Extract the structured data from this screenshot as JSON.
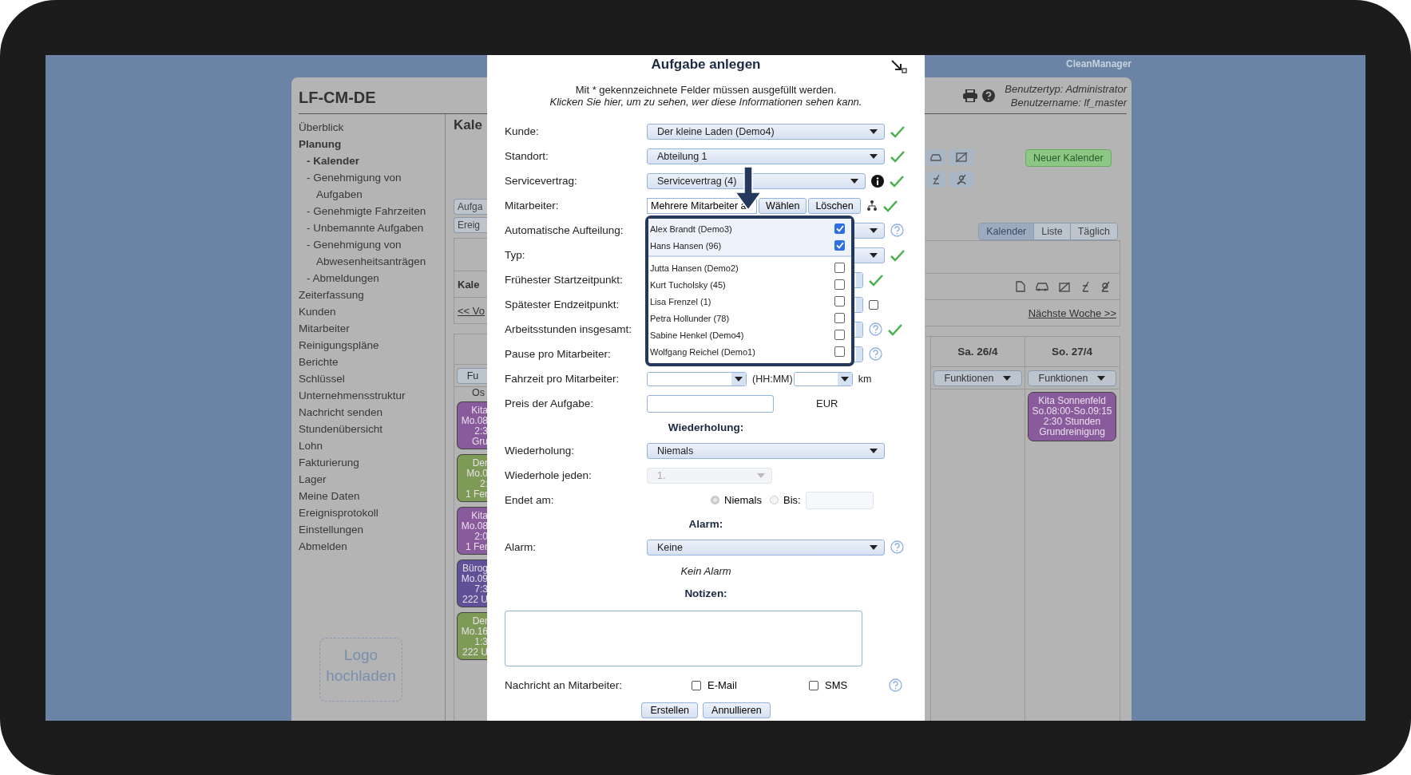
{
  "brand": "CleanManager",
  "app": {
    "title": "LF-CM-DE",
    "user_type": "Benutzertyp: Administrator",
    "user_name": "Benutzername: lf_master"
  },
  "sidebar": {
    "items": [
      {
        "label": "Überblick",
        "selected": false
      },
      {
        "label": "Planung",
        "expanded": true,
        "children": [
          {
            "label": "- Kalender",
            "selected": true
          },
          {
            "label": "- Genehmigung von Aufgaben",
            "selected": false
          },
          {
            "label": "- Genehmigte Fahrzeiten",
            "selected": false
          },
          {
            "label": "- Unbemannte Aufgaben",
            "selected": false
          },
          {
            "label": "- Genehmigung von Abwesenheitsanträgen",
            "selected": false
          },
          {
            "label": "- Abmeldungen",
            "selected": false
          }
        ]
      },
      {
        "label": "Zeiterfassung",
        "selected": false
      },
      {
        "label": "Kunden",
        "selected": false
      },
      {
        "label": "Mitarbeiter",
        "selected": false
      },
      {
        "label": "Reinigungspläne",
        "selected": false
      },
      {
        "label": "Berichte",
        "selected": false
      },
      {
        "label": "Schlüssel",
        "selected": false
      },
      {
        "label": "Unternehmensstruktur",
        "selected": false
      },
      {
        "label": "Nachricht senden",
        "selected": false
      },
      {
        "label": "Stundenübersicht",
        "selected": false
      },
      {
        "label": "Lohn",
        "selected": false
      },
      {
        "label": "Fakturierung",
        "selected": false
      },
      {
        "label": "Lager",
        "selected": false
      },
      {
        "label": "Meine Daten",
        "selected": false
      },
      {
        "label": "Ereignisprotokoll",
        "selected": false
      },
      {
        "label": "Einstellungen",
        "selected": false
      },
      {
        "label": "Abmelden",
        "selected": false
      }
    ],
    "logo_upload": "Logo hochladen"
  },
  "calendar_left": {
    "title": "Kale",
    "buttons": [
      "Aufga",
      "Ereig"
    ],
    "subtitle": "Kale",
    "prev_link": "<< Vo",
    "function_button": "Fu",
    "note": "Os",
    "events": [
      {
        "lines": [
          "Kita",
          "Mo.08",
          "2:3",
          "Gru"
        ],
        "color": "#8a5b9c"
      },
      {
        "lines": [
          "Der",
          "Mo.0",
          "2:",
          "1 Fer"
        ],
        "color": "#7e9a57"
      },
      {
        "lines": [
          "Kita",
          "Mo.08",
          "2:0",
          "1 Fer"
        ],
        "color": "#8a5b9c"
      },
      {
        "lines": [
          "Bürog",
          "Mo.09",
          "7:3",
          "222 U"
        ],
        "color": "#5f5197"
      },
      {
        "lines": [
          "Der",
          "Mo.16",
          "1:3",
          "222 U"
        ],
        "color": "#7e9a57"
      }
    ]
  },
  "calendar_right": {
    "new_calendar": "Neuer Kalender",
    "views": [
      {
        "label": "Kalender",
        "selected": true
      },
      {
        "label": "Liste",
        "selected": false
      },
      {
        "label": "Täglich",
        "selected": false
      }
    ],
    "next_link": "Nächste Woche >>",
    "days": [
      {
        "label": "Sa. 26/4",
        "function_button": "Funktionen"
      },
      {
        "label": "So. 27/4",
        "function_button": "Funktionen",
        "events": [
          {
            "lines": [
              "Kita Sonnenfeld",
              "So.08:00-So.09:15",
              "2:30 Stunden",
              "Grundreinigung"
            ],
            "color": "#8a5b9c"
          }
        ]
      }
    ]
  },
  "dialog": {
    "title": "Aufgabe anlegen",
    "notice": "Mit * gekennzeichnete Felder müssen ausgefüllt werden.",
    "visibility_link": "Klicken Sie hier, um zu sehen, wer diese Informationen sehen kann.",
    "fields": [
      {
        "label": "Kunde:",
        "kind": "select",
        "value": "Der kleine Laden (Demo4)",
        "marks": [
          {
            "kind": "check"
          }
        ]
      },
      {
        "label": "Standort:",
        "kind": "select",
        "value": "Abteilung 1",
        "marks": [
          {
            "kind": "check"
          }
        ]
      },
      {
        "label": "Servicevertrag:",
        "kind": "select_short",
        "value": "Servicevertrag (4)",
        "marks": [
          {
            "kind": "info"
          },
          {
            "kind": "check"
          }
        ]
      },
      {
        "label": "Mitarbeiter:",
        "kind": "employees",
        "value": "Mehrere Mitarbeiter a",
        "buttons": [
          "Wählen",
          "Löschen"
        ],
        "marks": [
          {
            "kind": "org"
          },
          {
            "kind": "check"
          }
        ]
      },
      {
        "label": "Automatische Aufteilung:",
        "kind": "select",
        "marks": [
          {
            "kind": "help"
          }
        ]
      },
      {
        "label": "Typ:",
        "kind": "select",
        "marks": [
          {
            "kind": "check"
          }
        ]
      },
      {
        "label": "Frühester Startzeitpunkt:",
        "kind": "time",
        "marks": [
          {
            "kind": "check"
          }
        ]
      },
      {
        "label": "Spätester Endzeitpunkt:",
        "kind": "time",
        "marks": [
          {
            "kind": "checkbox",
            "checked": false
          }
        ]
      },
      {
        "label": "Arbeitsstunden insgesamt:",
        "kind": "time",
        "marks": [
          {
            "kind": "help"
          },
          {
            "kind": "check"
          }
        ]
      },
      {
        "label": "Pause pro Mitarbeiter:",
        "kind": "time",
        "marks": [
          {
            "kind": "help"
          }
        ]
      },
      {
        "label": "Fahrzeit pro Mitarbeiter:",
        "kind": "travel",
        "unit_time": "(HH:MM)",
        "unit_distance": "km"
      },
      {
        "label": "Preis der Aufgabe:",
        "kind": "price",
        "unit": "EUR"
      },
      {
        "label": "Wiederholung:",
        "kind": "heading"
      },
      {
        "label": "Wiederholung:",
        "kind": "select",
        "value": "Niemals"
      },
      {
        "label": "Wiederhole jeden:",
        "kind": "select_disabled",
        "value": "1."
      },
      {
        "label": "Endet am:",
        "kind": "ends",
        "options": [
          {
            "label": "Niemals",
            "selected": true
          },
          {
            "label": "Bis:",
            "selected": false
          }
        ]
      },
      {
        "label": "Alarm:",
        "kind": "heading"
      },
      {
        "label": "Alarm:",
        "kind": "select",
        "value": "Keine",
        "marks": [
          {
            "kind": "help"
          }
        ]
      },
      {
        "label": "Kein Alarm",
        "kind": "note"
      },
      {
        "label": "Notizen:",
        "kind": "heading"
      },
      {
        "kind": "textarea"
      },
      {
        "label": "Nachricht an Mitarbeiter:",
        "kind": "notify",
        "options": [
          {
            "label": "E-Mail",
            "checked": false
          },
          {
            "label": "SMS",
            "checked": false
          }
        ],
        "marks": [
          {
            "kind": "help"
          }
        ]
      }
    ],
    "employee_list": [
      {
        "name": "Alex Brandt (Demo3)",
        "checked": true
      },
      {
        "name": "Hans Hansen (96)",
        "checked": true
      },
      {
        "name": "Jutta Hansen (Demo2)",
        "checked": false
      },
      {
        "name": "Kurt Tucholsky (45)",
        "checked": false
      },
      {
        "name": "Lisa Frenzel (1)",
        "checked": false
      },
      {
        "name": "Petra Hollunder (78)",
        "checked": false
      },
      {
        "name": "Sabine Henkel (Demo4)",
        "checked": false
      },
      {
        "name": "Wolfgang Reichel (Demo1)",
        "checked": false
      }
    ],
    "buttons": [
      "Erstellen",
      "Annullieren"
    ]
  }
}
